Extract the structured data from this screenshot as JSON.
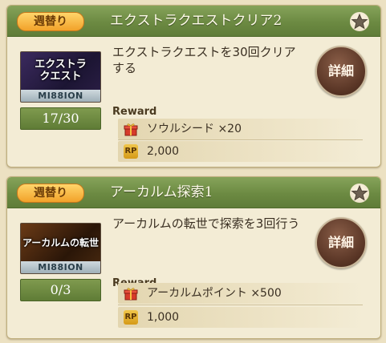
{
  "missions": [
    {
      "badge": "週替り",
      "title": "エクストラクエストクリア2",
      "thumb_text": "エクストラ\nクエスト",
      "thumb_band": "MI88ION",
      "progress": "17/30",
      "description": "エクストラクエストを30回クリアする",
      "detail_label": "詳細",
      "reward_label": "Reward",
      "rewards": [
        {
          "icon": "gift-icon",
          "text": "ソウルシード ×20"
        },
        {
          "icon": "RP",
          "text": "2,000"
        }
      ]
    },
    {
      "badge": "週替り",
      "title": "アーカルム探索1",
      "thumb_text": "アーカルムの転世",
      "thumb_band": "MI88ION",
      "progress": "0/3",
      "description": "アーカルムの転世で探索を3回行う",
      "detail_label": "詳細",
      "reward_label": "Reward",
      "rewards": [
        {
          "icon": "gift-icon",
          "text": "アーカルムポイント ×500"
        },
        {
          "icon": "RP",
          "text": "1,000"
        }
      ]
    }
  ],
  "colors": {
    "header_green": "#6c8a42",
    "badge_orange": "#f2a22a",
    "detail_brown": "#5a3626",
    "card_bg": "#f3ecd5"
  }
}
